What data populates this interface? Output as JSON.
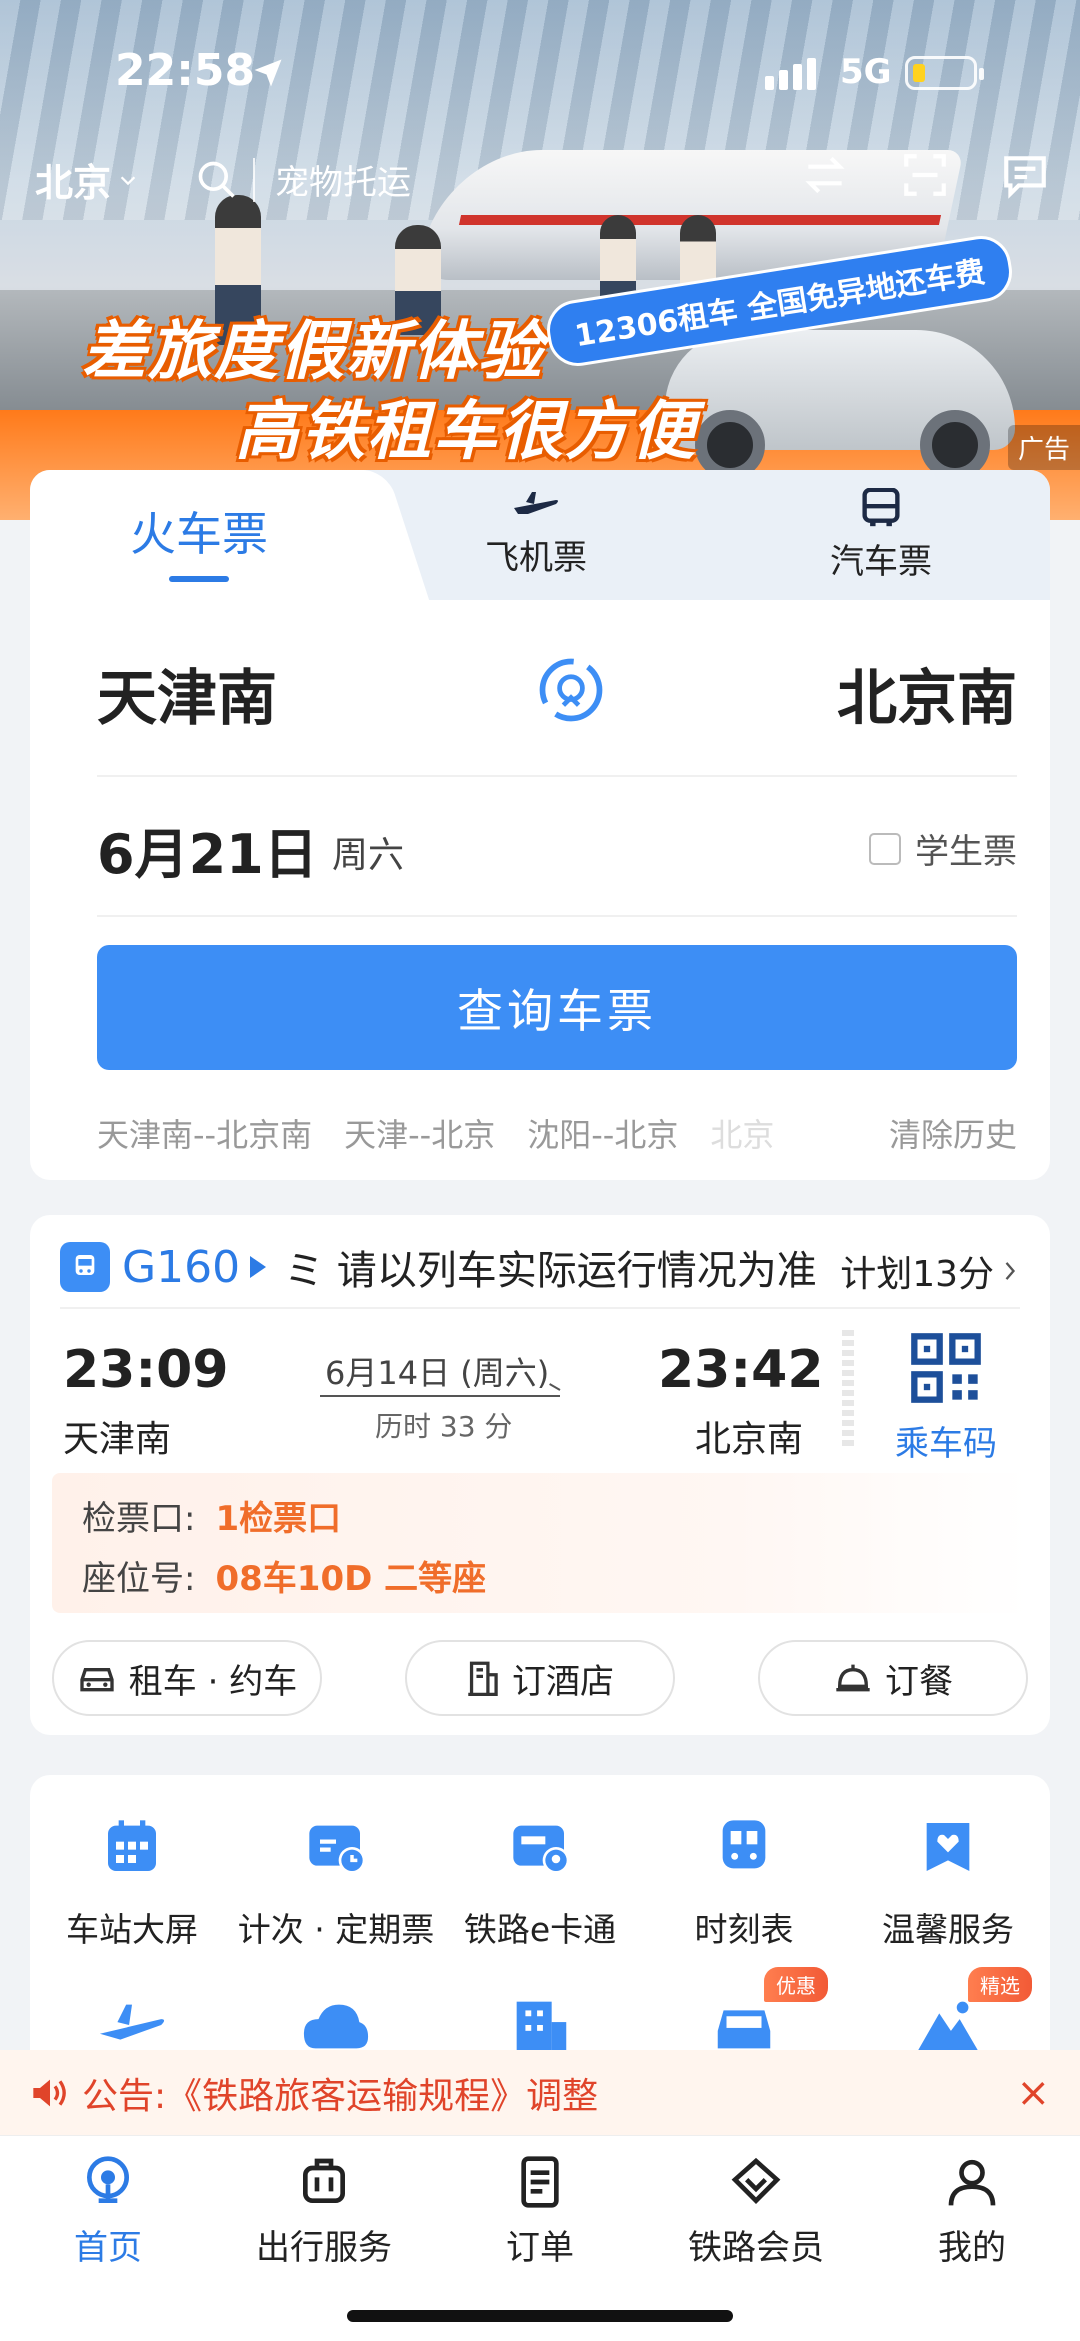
{
  "status_bar": {
    "time": "22:58",
    "network": "5G"
  },
  "top_bar": {
    "city": "北京",
    "search_placeholder": "宠物托运"
  },
  "banner": {
    "line1": "差旅度假新体验",
    "line2": "高铁租车很方便",
    "tag": "12306租车 全国免异地还车费",
    "ad_label": "广告"
  },
  "ticket_tabs": [
    {
      "label": "火车票",
      "icon": "train-ticket",
      "active": true
    },
    {
      "label": "飞机票",
      "icon": "airplane-icon",
      "active": false
    },
    {
      "label": "汽车票",
      "icon": "bus-icon",
      "active": false
    }
  ],
  "search_form": {
    "from": "天津南",
    "to": "北京南",
    "date": "6月21日",
    "weekday": "周六",
    "student_label": "学生票",
    "query_button": "查询车票",
    "history": [
      "天津南--北京南",
      "天津--北京",
      "沈阳--北京",
      "北京"
    ],
    "clear_history": "清除历史"
  },
  "trip": {
    "train_number": "G160",
    "notice_prefix": "ミ",
    "notice": "请以列车实际运行情况为准",
    "plan": "计划13分",
    "dep_time": "23:09",
    "dep_station": "天津南",
    "date": "6月14日 (周六)",
    "duration": "历时 33 分",
    "arr_time": "23:42",
    "arr_station": "北京南",
    "ride_code_label": "乘车码",
    "gate_label": "检票口:",
    "gate_value": "1检票口",
    "seat_label": "座位号:",
    "seat_value": "08车10D 二等座",
    "services": [
      "租车 · 约车",
      "订酒店",
      "订餐"
    ]
  },
  "services_grid": {
    "row1": [
      "车站大屏",
      "计次 · 定期票",
      "铁路e卡通",
      "时刻表",
      "温馨服务"
    ],
    "tags": [
      "优惠",
      "精选"
    ]
  },
  "announcement": {
    "text": "公告:《铁路旅客运输规程》调整",
    "close": "×"
  },
  "bottom_nav": [
    {
      "label": "首页",
      "active": true
    },
    {
      "label": "出行服务",
      "active": false
    },
    {
      "label": "订单",
      "active": false
    },
    {
      "label": "铁路会员",
      "active": false
    },
    {
      "label": "我的",
      "active": false
    }
  ],
  "colors": {
    "accent": "#2c7be5",
    "button": "#3d8ef5",
    "warning": "#f06d2a",
    "banner_orange": "#ff7a1a"
  }
}
